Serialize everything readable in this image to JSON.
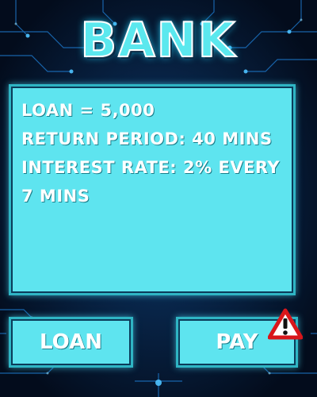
{
  "title": "BANK",
  "info": {
    "loan": "LOAN = 5,000",
    "return_period": "RETURN PERIOD: 40 MINS",
    "interest_rate": "INTEREST RATE: 2% EVERY 7 MINS"
  },
  "buttons": {
    "loan_label": "LOAN",
    "pay_label": "PAY"
  },
  "icons": {
    "warning": "warning-icon"
  },
  "colors": {
    "panel": "#5ee4ef",
    "title": "#5be8ee",
    "text": "#ffffff",
    "warning_red": "#d8161b"
  }
}
